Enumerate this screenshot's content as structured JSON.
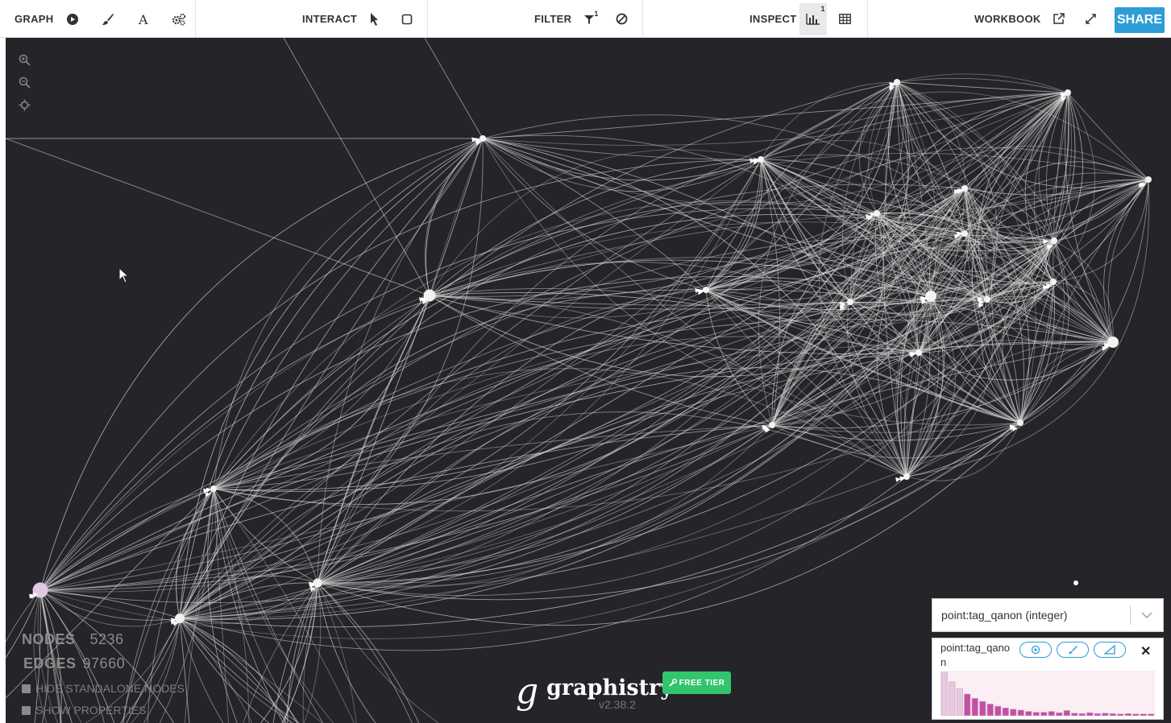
{
  "toolbar": {
    "graph_label": "GRAPH",
    "interact_label": "INTERACT",
    "filter_label": "FILTER",
    "filter_badge": "1",
    "inspect_label": "INSPECT",
    "inspect_badge": "1",
    "workbook_label": "WORKBOOK",
    "share_label": "SHARE",
    "icons": [
      "play-icon",
      "brush-icon",
      "font-icon",
      "gears-icon",
      "pointer-icon",
      "box-select-icon",
      "funnel-icon",
      "exclude-icon",
      "histogram-icon",
      "table-icon",
      "external-link-icon",
      "fullscreen-icon"
    ]
  },
  "zoom_controls": [
    "zoom-in-icon",
    "zoom-out-icon",
    "center-icon"
  ],
  "stats": {
    "nodes_label": "NODES",
    "nodes_value": "5236",
    "edges_label": "EDGES",
    "edges_value": "97660"
  },
  "options": {
    "hide_standalone": "HIDE STANDALONE NODES",
    "show_properties": "SHOW PROPERTIES"
  },
  "brand": {
    "name": "graphistry",
    "version": "v2.38.2",
    "tier": "FREE TIER"
  },
  "histogram_panel": {
    "selected_attribute": "point:tag_qanon (integer)",
    "title": "point:tag_qanon",
    "bar_heights": [
      1.0,
      0.78,
      0.62,
      0.5,
      0.4,
      0.33,
      0.27,
      0.22,
      0.18,
      0.15,
      0.13,
      0.1,
      0.08,
      0.08,
      0.1,
      0.07,
      0.12,
      0.06,
      0.05,
      0.07,
      0.05,
      0.06,
      0.05,
      0.04,
      0.05,
      0.04,
      0.04,
      0.04
    ],
    "highlight_color": "#c54fa5",
    "base_color": "#e8c9df"
  },
  "colors": {
    "canvas": "#252428",
    "share": "#2e9cd6",
    "free_tier": "#33c46e",
    "highlight_node": "#e3c8e6"
  }
}
